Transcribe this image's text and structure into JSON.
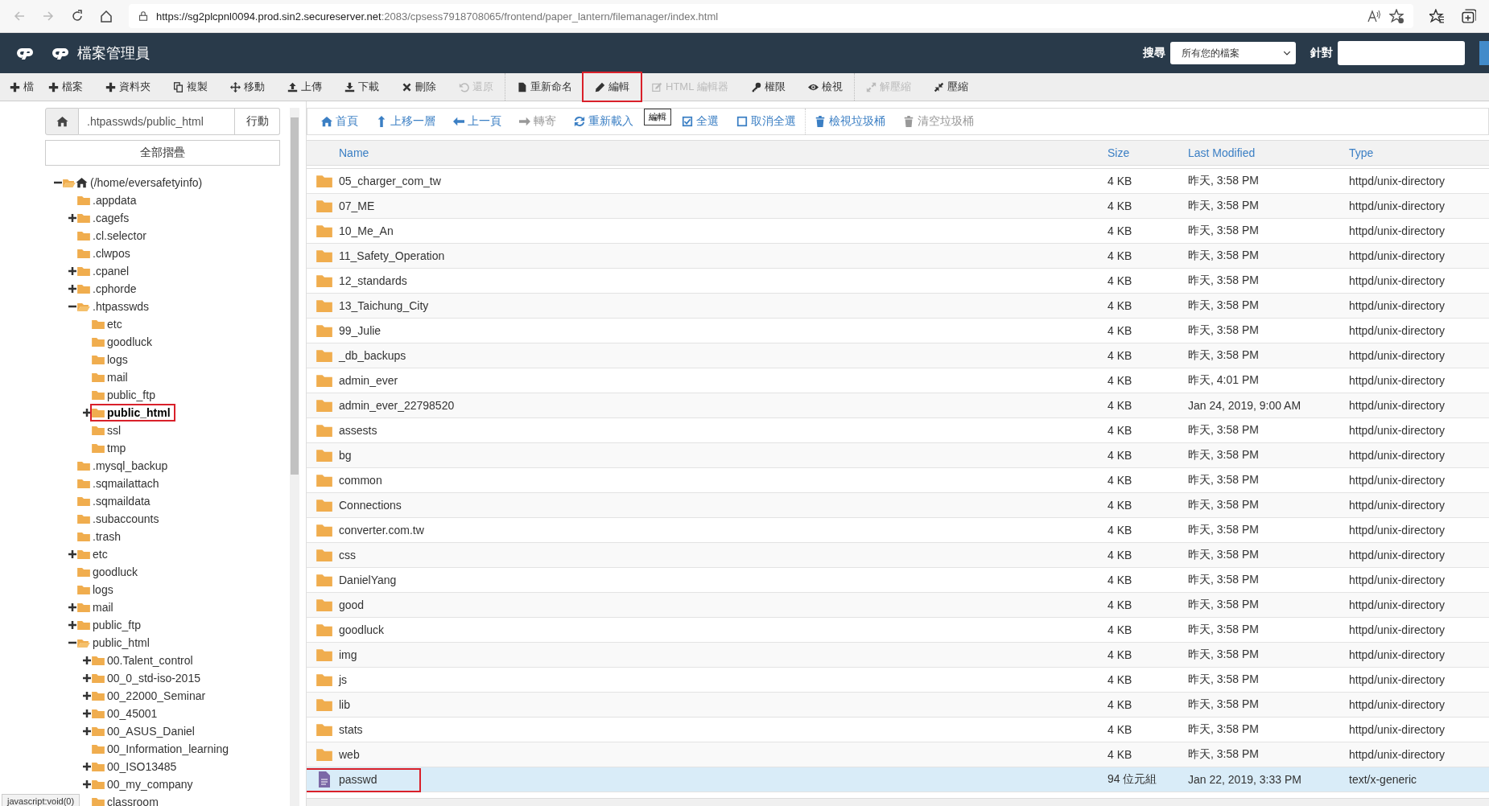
{
  "browser": {
    "url_host": "https://sg2plcpnl0094.prod.sin2.secureserver.net",
    "url_rest": ":2083/cpsess7918708065/frontend/paper_lantern/filemanager/index.html"
  },
  "header": {
    "title": "檔案管理員",
    "search_label": "搜尋",
    "search_scope": "所有您的檔案",
    "for_label": "針對"
  },
  "toolbar": [
    {
      "label": "檔",
      "disabled": false,
      "highlighted": false
    },
    {
      "label": "檔案",
      "disabled": false,
      "highlighted": false
    },
    {
      "label": "資料夾",
      "disabled": false,
      "highlighted": false
    },
    {
      "label": "複製",
      "disabled": false,
      "highlighted": false
    },
    {
      "label": "移動",
      "disabled": false,
      "highlighted": false
    },
    {
      "label": "上傳",
      "disabled": false,
      "highlighted": false
    },
    {
      "label": "下載",
      "disabled": false,
      "highlighted": false
    },
    {
      "label": "刪除",
      "disabled": false,
      "highlighted": false
    },
    {
      "label": "還原",
      "disabled": true,
      "highlighted": false
    },
    {
      "label": "重新命名",
      "disabled": false,
      "highlighted": false
    },
    {
      "label": "編輯",
      "disabled": false,
      "highlighted": true,
      "tooltip": "編輯"
    },
    {
      "label": "HTML 編輯器",
      "disabled": true,
      "highlighted": false
    },
    {
      "label": "權限",
      "disabled": false,
      "highlighted": false
    },
    {
      "label": "檢視",
      "disabled": false,
      "highlighted": false
    },
    {
      "label": "解壓縮",
      "disabled": true,
      "highlighted": false
    },
    {
      "label": "壓縮",
      "disabled": false,
      "highlighted": false
    }
  ],
  "path_bar": {
    "path": ".htpasswds/public_html",
    "go": "行動"
  },
  "collapse_all": "全部摺疊",
  "tree": {
    "label": "(/home/eversafetyinfo)",
    "expanded": true,
    "children": [
      {
        "label": ".appdata"
      },
      {
        "label": ".cagefs",
        "expanded": false
      },
      {
        "label": ".cl.selector"
      },
      {
        "label": ".clwpos"
      },
      {
        "label": ".cpanel",
        "expanded": false
      },
      {
        "label": ".cphorde",
        "expanded": false
      },
      {
        "label": ".htpasswds",
        "expanded": true,
        "children": [
          {
            "label": "etc"
          },
          {
            "label": "goodluck"
          },
          {
            "label": "logs"
          },
          {
            "label": "mail"
          },
          {
            "label": "public_ftp"
          },
          {
            "label": "public_html",
            "expanded": false,
            "selected": true,
            "highlighted": true
          },
          {
            "label": "ssl"
          },
          {
            "label": "tmp"
          }
        ]
      },
      {
        "label": ".mysql_backup"
      },
      {
        "label": ".sqmailattach"
      },
      {
        "label": ".sqmaildata"
      },
      {
        "label": ".subaccounts"
      },
      {
        "label": ".trash"
      },
      {
        "label": "etc",
        "expanded": false
      },
      {
        "label": "goodluck"
      },
      {
        "label": "logs"
      },
      {
        "label": "mail",
        "expanded": false
      },
      {
        "label": "public_ftp",
        "expanded": false
      },
      {
        "label": "public_html",
        "expanded": true,
        "children": [
          {
            "label": "00.Talent_control",
            "expanded": false
          },
          {
            "label": "00_0_std-iso-2015",
            "expanded": false
          },
          {
            "label": "00_22000_Seminar",
            "expanded": false
          },
          {
            "label": "00_45001",
            "expanded": false
          },
          {
            "label": "00_ASUS_Daniel",
            "expanded": false
          },
          {
            "label": "00_Information_learning"
          },
          {
            "label": "00_ISO13485",
            "expanded": false
          },
          {
            "label": "00_my_company",
            "expanded": false
          },
          {
            "label": "classroom"
          }
        ]
      }
    ]
  },
  "status_link": "javascript:void(0)",
  "nav": [
    {
      "label": "首頁",
      "disabled": false
    },
    {
      "label": "上移一層",
      "disabled": false
    },
    {
      "label": "上一頁",
      "disabled": false
    },
    {
      "label": "轉寄",
      "disabled": true
    },
    {
      "label": "重新載入",
      "disabled": false
    },
    {
      "label": "全選",
      "disabled": false
    },
    {
      "label": "取消全選",
      "disabled": false
    },
    {
      "label": "檢視垃圾桶",
      "disabled": false
    },
    {
      "label": "清空垃圾桶",
      "disabled": true
    }
  ],
  "table": {
    "columns": [
      "Name",
      "Size",
      "Last Modified",
      "Type"
    ],
    "rows": [
      {
        "kind": "folder",
        "name": "05_charger_com_tw",
        "size": "4 KB",
        "modified": "昨天, 3:58 PM",
        "type": "httpd/unix-directory",
        "selected": false
      },
      {
        "kind": "folder",
        "name": "07_ME",
        "size": "4 KB",
        "modified": "昨天, 3:58 PM",
        "type": "httpd/unix-directory",
        "selected": false
      },
      {
        "kind": "folder",
        "name": "10_Me_An",
        "size": "4 KB",
        "modified": "昨天, 3:58 PM",
        "type": "httpd/unix-directory",
        "selected": false
      },
      {
        "kind": "folder",
        "name": "11_Safety_Operation",
        "size": "4 KB",
        "modified": "昨天, 3:58 PM",
        "type": "httpd/unix-directory",
        "selected": false
      },
      {
        "kind": "folder",
        "name": "12_standards",
        "size": "4 KB",
        "modified": "昨天, 3:58 PM",
        "type": "httpd/unix-directory",
        "selected": false
      },
      {
        "kind": "folder",
        "name": "13_Taichung_City",
        "size": "4 KB",
        "modified": "昨天, 3:58 PM",
        "type": "httpd/unix-directory",
        "selected": false
      },
      {
        "kind": "folder",
        "name": "99_Julie",
        "size": "4 KB",
        "modified": "昨天, 3:58 PM",
        "type": "httpd/unix-directory",
        "selected": false
      },
      {
        "kind": "folder",
        "name": "_db_backups",
        "size": "4 KB",
        "modified": "昨天, 3:58 PM",
        "type": "httpd/unix-directory",
        "selected": false
      },
      {
        "kind": "folder",
        "name": "admin_ever",
        "size": "4 KB",
        "modified": "昨天, 4:01 PM",
        "type": "httpd/unix-directory",
        "selected": false
      },
      {
        "kind": "folder",
        "name": "admin_ever_22798520",
        "size": "4 KB",
        "modified": "Jan 24, 2019, 9:00 AM",
        "type": "httpd/unix-directory",
        "selected": false
      },
      {
        "kind": "folder",
        "name": "assests",
        "size": "4 KB",
        "modified": "昨天, 3:58 PM",
        "type": "httpd/unix-directory",
        "selected": false
      },
      {
        "kind": "folder",
        "name": "bg",
        "size": "4 KB",
        "modified": "昨天, 3:58 PM",
        "type": "httpd/unix-directory",
        "selected": false
      },
      {
        "kind": "folder",
        "name": "common",
        "size": "4 KB",
        "modified": "昨天, 3:58 PM",
        "type": "httpd/unix-directory",
        "selected": false
      },
      {
        "kind": "folder",
        "name": "Connections",
        "size": "4 KB",
        "modified": "昨天, 3:58 PM",
        "type": "httpd/unix-directory",
        "selected": false
      },
      {
        "kind": "folder",
        "name": "converter.com.tw",
        "size": "4 KB",
        "modified": "昨天, 3:58 PM",
        "type": "httpd/unix-directory",
        "selected": false
      },
      {
        "kind": "folder",
        "name": "css",
        "size": "4 KB",
        "modified": "昨天, 3:58 PM",
        "type": "httpd/unix-directory",
        "selected": false
      },
      {
        "kind": "folder",
        "name": "DanielYang",
        "size": "4 KB",
        "modified": "昨天, 3:58 PM",
        "type": "httpd/unix-directory",
        "selected": false
      },
      {
        "kind": "folder",
        "name": "good",
        "size": "4 KB",
        "modified": "昨天, 3:58 PM",
        "type": "httpd/unix-directory",
        "selected": false
      },
      {
        "kind": "folder",
        "name": "goodluck",
        "size": "4 KB",
        "modified": "昨天, 3:58 PM",
        "type": "httpd/unix-directory",
        "selected": false
      },
      {
        "kind": "folder",
        "name": "img",
        "size": "4 KB",
        "modified": "昨天, 3:58 PM",
        "type": "httpd/unix-directory",
        "selected": false
      },
      {
        "kind": "folder",
        "name": "js",
        "size": "4 KB",
        "modified": "昨天, 3:58 PM",
        "type": "httpd/unix-directory",
        "selected": false
      },
      {
        "kind": "folder",
        "name": "lib",
        "size": "4 KB",
        "modified": "昨天, 3:58 PM",
        "type": "httpd/unix-directory",
        "selected": false
      },
      {
        "kind": "folder",
        "name": "stats",
        "size": "4 KB",
        "modified": "昨天, 3:58 PM",
        "type": "httpd/unix-directory",
        "selected": false
      },
      {
        "kind": "folder",
        "name": "web",
        "size": "4 KB",
        "modified": "昨天, 3:58 PM",
        "type": "httpd/unix-directory",
        "selected": false
      },
      {
        "kind": "file",
        "name": "passwd",
        "size": "94 位元組",
        "modified": "Jan 22, 2019, 3:33 PM",
        "type": "text/x-generic",
        "selected": true,
        "highlighted": true
      }
    ]
  }
}
